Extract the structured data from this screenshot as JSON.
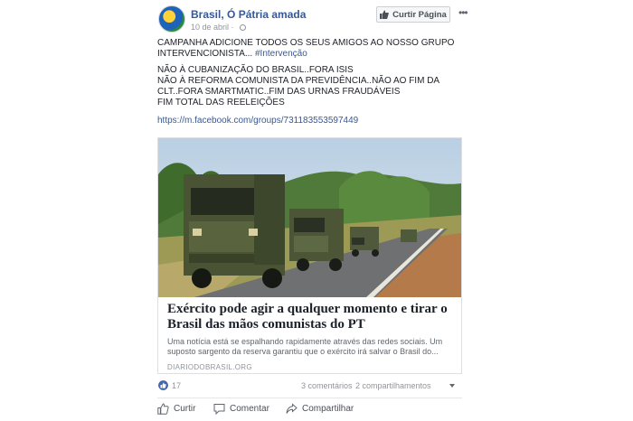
{
  "page": {
    "name": "Brasil, Ó Pátria amada",
    "date": "10 de abril",
    "separator": "·",
    "like_page_label": "Curtir Página",
    "more_label": "•••"
  },
  "post": {
    "line1": "CAMPANHA ADICIONE TODOS OS SEUS AMIGOS AO NOSSO GRUPO INTERVENCIONISTA... ",
    "hashtag": "#Intervenção",
    "line2": "NÃO À CUBANIZAÇÃO DO BRASIL..FORA ISIS",
    "line3": "NÃO À REFORMA COMUNISTA DA PREVIDÊNCIA..NÃO AO FIM DA CLT..FORA SMARTMATIC..FIM DAS URNAS FRAUDÁVEIS",
    "line4": "FIM TOTAL DAS REELEIÇÕES",
    "link": "https://m.facebook.com/groups/731183553597449"
  },
  "card": {
    "title": "Exército pode agir a qualquer momento e tirar o Brasil das mãos comunistas do PT",
    "description": "Uma notícia está se espalhando rapidamente através das redes sociais. Um suposto sargento da reserva garantiu que o exército irá salvar o Brasil do...",
    "source": "DIARIODOBRASIL.ORG"
  },
  "stats": {
    "likes": "17",
    "comments": "3 comentários",
    "shares": "2 compartilhamentos"
  },
  "actions": {
    "like": "Curtir",
    "comment": "Comentar",
    "share": "Compartilhar"
  },
  "colors": {
    "link_blue": "#365899",
    "like_blue": "#4267b2",
    "muted": "#90949c"
  },
  "icons": [
    "globe-icon",
    "thumbs-up-icon",
    "more-icon",
    "like-reaction-icon",
    "comment-icon",
    "share-icon"
  ]
}
